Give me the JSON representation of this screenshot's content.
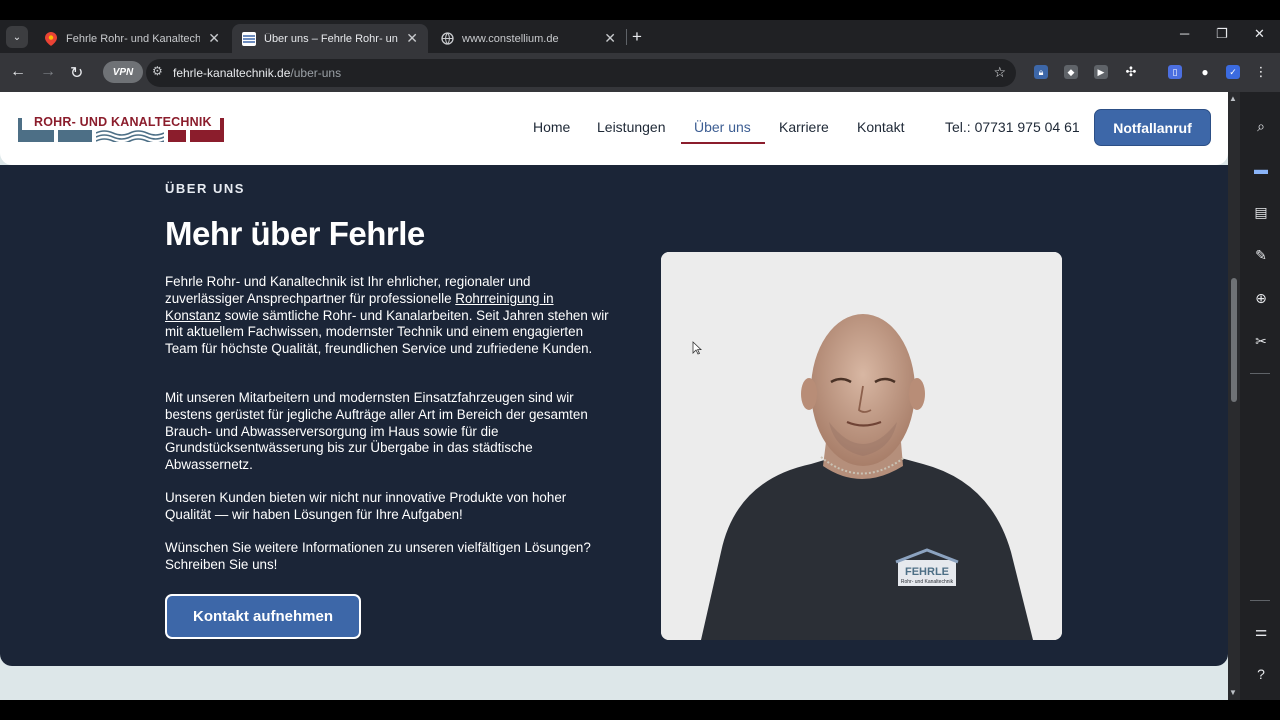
{
  "browser": {
    "tabs": [
      {
        "title": "Fehrle Rohr- und Kanaltechnik",
        "active": false
      },
      {
        "title": "Über uns – Fehrle Rohr- und Ka",
        "active": true
      },
      {
        "title": "www.constellium.de",
        "active": false
      }
    ],
    "vpn_label": "VPN",
    "url_host": "fehrle-kanaltechnik.de",
    "url_path": "/uber-uns"
  },
  "site": {
    "logo_text": "ROHR- UND KANALTECHNIK",
    "nav": [
      {
        "label": "Home",
        "active": false
      },
      {
        "label": "Leistungen",
        "active": false
      },
      {
        "label": "Über uns",
        "active": true
      },
      {
        "label": "Karriere",
        "active": false
      },
      {
        "label": "Kontakt",
        "active": false
      }
    ],
    "phone": "Tel.: 07731 975 04 61",
    "emergency_button": "Notfallanruf"
  },
  "hero": {
    "eyebrow": "ÜBER UNS",
    "title": "Mehr über Fehrle",
    "p1_before": "Fehrle Rohr- und Kanaltechnik ist Ihr ehrlicher, regionaler und zuverlässiger Ansprechpartner für professionelle ",
    "p1_link": "Rohrreinigung in Konstanz",
    "p1_after": " sowie sämtliche Rohr- und Kanalarbeiten. Seit Jahren stehen wir mit aktuellem Fachwissen, modernster Technik und einem engagierten Team für höchste Qualität, freundlichen Service und zufriedene Kunden.",
    "p2": "Mit unseren Mitarbeitern und modernsten Einsatzfahrzeugen sind wir bestens gerüstet für jegliche Aufträge aller Art im Bereich der gesamten Brauch- und Abwasserversorgung im Haus sowie für die Grundstücksentwässerung bis zur Übergabe in das städtische Abwassernetz.",
    "p3": "Unseren Kunden bieten wir nicht nur innovative Produkte von hoher Qualität — wir haben Lösungen für Ihre Aufgaben!",
    "p4": "Wünschen Sie weitere Informationen zu unseren vielfältigen Lösungen? Schreiben Sie uns!",
    "cta": "Kontakt aufnehmen",
    "shirt_logo_text": "FEHRLE",
    "shirt_logo_sub": "Rohr- und Kanaltechnik"
  },
  "colors": {
    "brand_red": "#8b1d2c",
    "brand_blue": "#3d67a8",
    "hero_bg": "#1b2537"
  }
}
